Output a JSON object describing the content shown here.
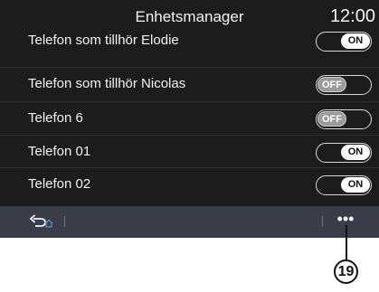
{
  "header": {
    "title": "Enhetsmanager",
    "clock": "12:00"
  },
  "devices": [
    {
      "name": "Telefon som tillhör Elodie",
      "toggle": "ON"
    },
    {
      "name": "Telefon som tillhör Nicolas",
      "toggle": "OFF"
    },
    {
      "name": "Telefon 6",
      "toggle": "OFF"
    },
    {
      "name": "Telefon 01",
      "toggle": "ON"
    },
    {
      "name": "Telefon 02",
      "toggle": "ON"
    }
  ],
  "bottombar": {
    "more_label": "•••",
    "back_icon": "back-home-icon"
  },
  "callout": {
    "number": "19"
  },
  "colors": {
    "screen_bg": "#1c1c1c",
    "bar_bg": "#3a3d48",
    "text": "#f2f2f2"
  }
}
